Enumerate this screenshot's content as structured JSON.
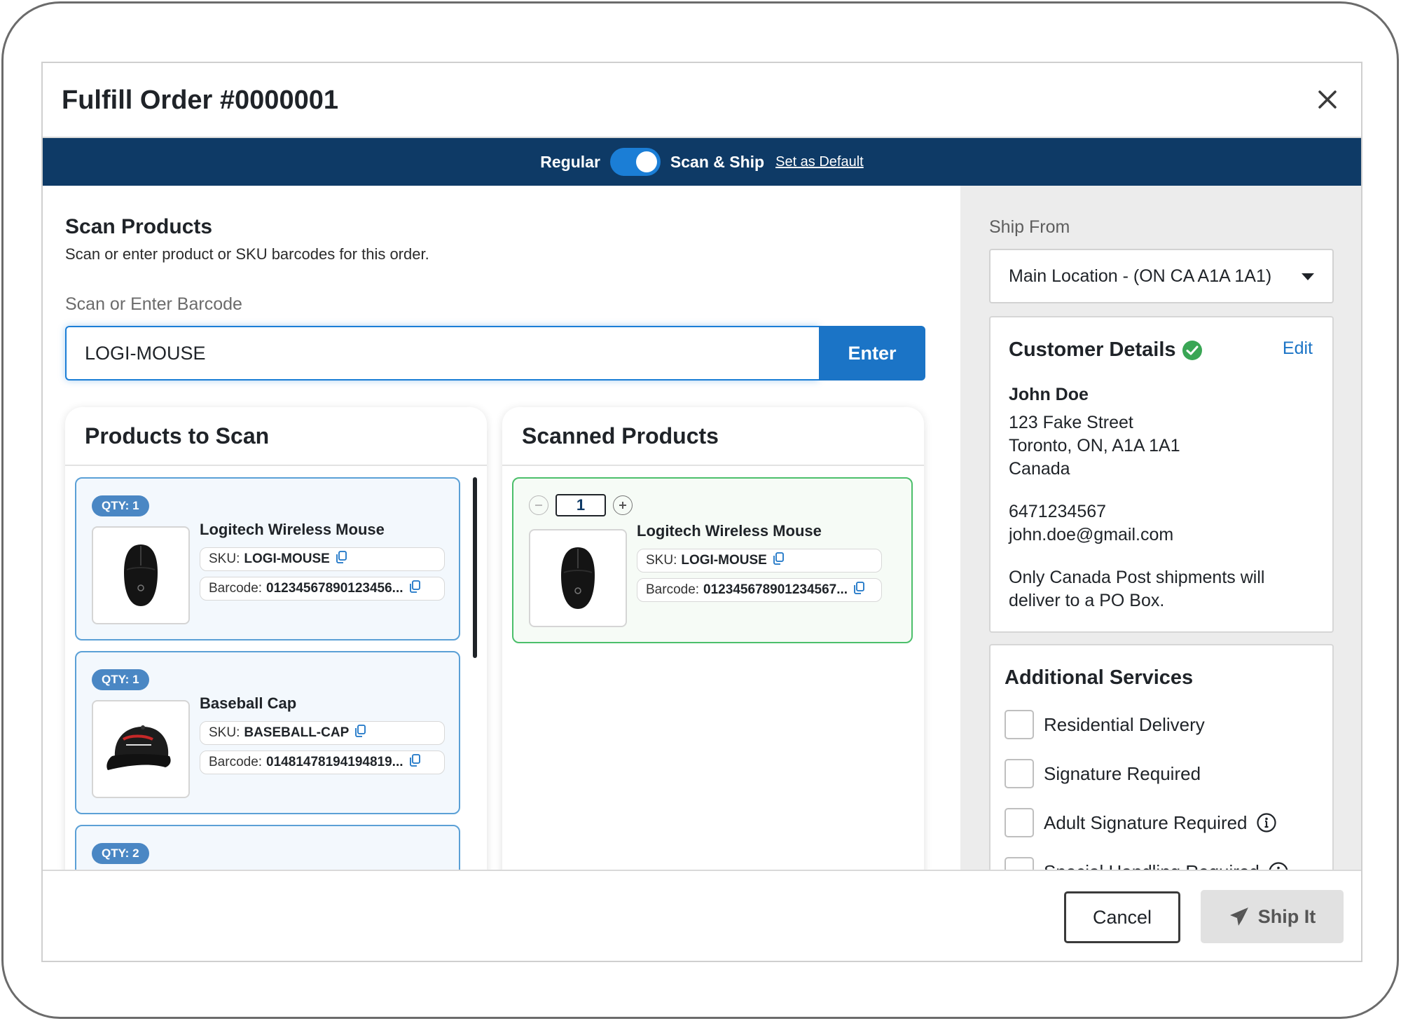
{
  "modal": {
    "title": "Fulfill Order #0000001"
  },
  "mode_bar": {
    "regular_label": "Regular",
    "scan_ship_label": "Scan & Ship",
    "set_default_label": "Set as Default",
    "toggle_on": true
  },
  "scan": {
    "title": "Scan Products",
    "subtitle": "Scan or enter product or SKU barcodes for this order.",
    "field_label": "Scan or Enter Barcode",
    "input_value": "LOGI-MOUSE",
    "enter_label": "Enter"
  },
  "products_to_scan": {
    "title": "Products to Scan",
    "items": [
      {
        "qty": "QTY: 1",
        "name": "Logitech Wireless Mouse",
        "sku_label": "SKU:",
        "sku": "LOGI-MOUSE",
        "barcode_label": "Barcode:",
        "barcode": "01234567890123456...",
        "image": "mouse"
      },
      {
        "qty": "QTY: 1",
        "name": "Baseball Cap",
        "sku_label": "SKU:",
        "sku": "BASEBALL-CAP",
        "barcode_label": "Barcode:",
        "barcode": "01481478194194819...",
        "image": "cap"
      },
      {
        "qty": "QTY: 2"
      }
    ]
  },
  "scanned_products": {
    "title": "Scanned Products",
    "items": [
      {
        "qty_value": "1",
        "name": "Logitech Wireless Mouse",
        "sku_label": "SKU:",
        "sku": "LOGI-MOUSE",
        "barcode_label": "Barcode:",
        "barcode": "012345678901234567...",
        "image": "mouse"
      }
    ]
  },
  "ship_from": {
    "label": "Ship From",
    "selected": "Main Location - (ON CA A1A 1A1)"
  },
  "customer": {
    "title": "Customer Details",
    "edit_label": "Edit",
    "name": "John Doe",
    "street": "123 Fake Street",
    "city_line": "Toronto, ON, A1A 1A1",
    "country": "Canada",
    "phone": "6471234567",
    "email": "john.doe@gmail.com",
    "note_line1": "Only Canada Post shipments will",
    "note_line2": "deliver to a PO Box."
  },
  "services": {
    "title": "Additional Services",
    "options": [
      {
        "label": "Residential Delivery",
        "checked": false
      },
      {
        "label": "Signature Required",
        "checked": false
      },
      {
        "label": "Adult Signature Required",
        "checked": false
      },
      {
        "label": "Special Handling Required",
        "checked": false
      }
    ]
  },
  "footer": {
    "cancel_label": "Cancel",
    "ship_label": "Ship It"
  },
  "colors": {
    "navy": "#0e3a66",
    "accent_blue": "#1b74c6",
    "success_green": "#3aa655",
    "disabled_gray": "#e1e1e1"
  }
}
